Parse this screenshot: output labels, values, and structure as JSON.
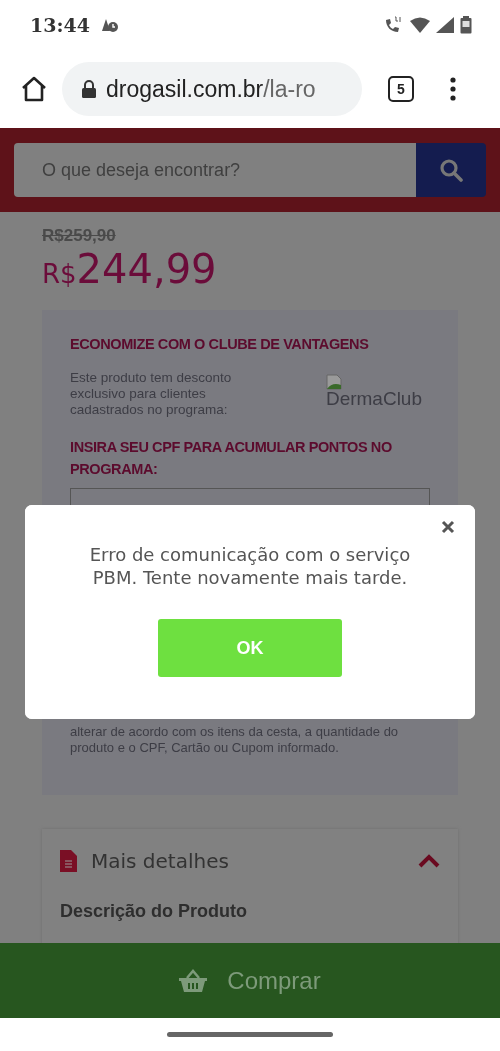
{
  "status_bar": {
    "time": "13:44"
  },
  "browser": {
    "url_domain": "drogasil.com.br",
    "url_path": "/la-ro",
    "tab_count": "5"
  },
  "search": {
    "placeholder": "O que deseja encontrar?"
  },
  "product": {
    "old_price": "R$259,90",
    "currency": "R$",
    "price": "244,99"
  },
  "club": {
    "title": "ECONOMIZE COM O CLUBE DE VANTAGENS",
    "description": "Este produto tem desconto exclusivo para clientes cadastrados no programa:",
    "logo_alt": "DermaClub",
    "cpf_title": "INSIRA SEU CPF PARA ACUMULAR PONTOS NO PROGRAMA:",
    "note_lines": [
      "alterar de acordo com os itens da cesta, a quantidade do",
      "produto e o CPF, Cartão ou Cupom informado."
    ]
  },
  "details": {
    "title": "Mais detalhes",
    "expanded": true,
    "subtitle": "Descrição do Produto"
  },
  "buy_button": {
    "label": "Comprar"
  },
  "dialog": {
    "message": "Erro de comunicação com o serviço PBM. Tente novamente mais tarde.",
    "button": "OK"
  }
}
